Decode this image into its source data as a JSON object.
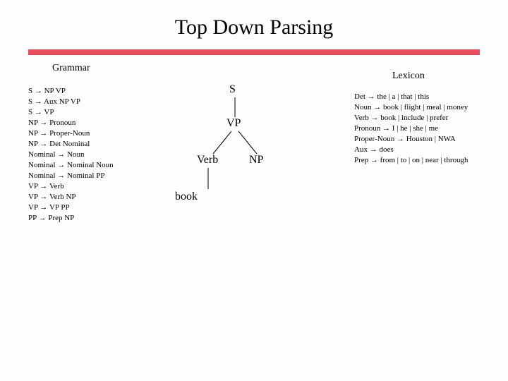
{
  "title": "Top Down Parsing",
  "sections": {
    "grammar_label": "Grammar",
    "lexicon_label": "Lexicon"
  },
  "grammar_rules": [
    "S → NP VP",
    "S → Aux NP VP",
    "S → VP",
    "NP → Pronoun",
    "NP → Proper-Noun",
    "NP → Det Nominal",
    "Nominal → Noun",
    "Nominal → Nominal Noun",
    "Nominal → Nominal PP",
    "VP → Verb",
    "VP → Verb NP",
    "VP → VP PP",
    "PP → Prep NP"
  ],
  "lexicon_rules": [
    "Det → the | a | that | this",
    "Noun → book | flight | meal | money",
    "Verb → book | include | prefer",
    "Pronoun → I | he | she | me",
    "Proper-Noun → Houston | NWA",
    "Aux → does",
    "Prep → from | to | on | near | through"
  ],
  "tree": {
    "n1": "S",
    "n2": "VP",
    "n3": "Verb",
    "n4": "NP",
    "n5": "book"
  }
}
